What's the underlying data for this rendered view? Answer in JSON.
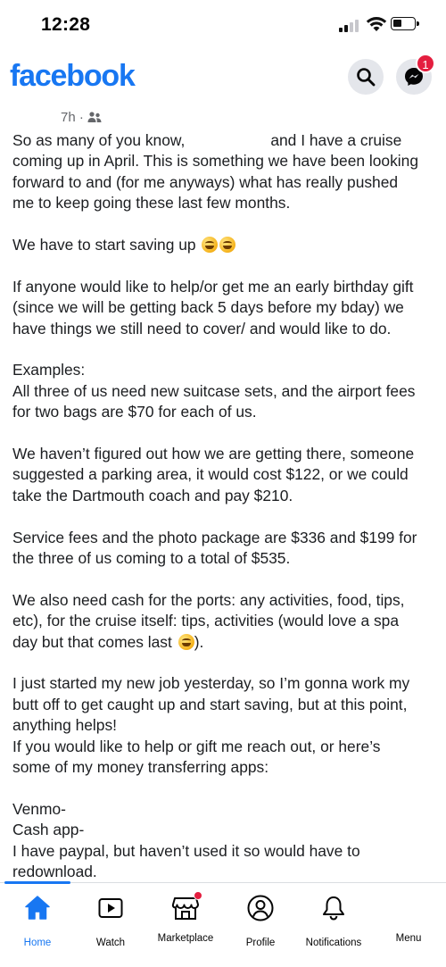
{
  "status_bar": {
    "time": "12:28"
  },
  "header": {
    "logo": "facebook",
    "messenger_badge": "1"
  },
  "post": {
    "time_ago": "7h ·",
    "paragraphs": {
      "p1_a": "So as many of you know,",
      "p1_b": "and I have a cruise\ncoming up in April. This is something we have been looking\nforward to and (for me anyways) what has really pushed\nme to keep going these last few months.",
      "p2": "We have to start saving up",
      "p3": "If anyone would like to help/or get me an early birthday gift\n(since we will be getting back 5 days before my bday) we\nhave things we still need to cover/ and would like to do.",
      "p4": "Examples:\nAll three of us need new suitcase sets, and the airport fees\nfor two bags are $70 for each of us.",
      "p5": "We haven’t figured out how we are getting there, someone\nsuggested a parking area, it would cost $122, or we could\ntake the Dartmouth coach and pay $210.",
      "p6": "Service fees and the photo package are $336 and $199 for\nthe three of us coming to a total of $535.",
      "p7_a": "We also need cash for the ports: any activities, food, tips,\netc), for the cruise itself: tips, activities (would love a spa\nday but that comes last",
      "p7_b": ").",
      "p8": "I just started my new job yesterday, so I’m gonna work my\nbutt off to get caught up and start saving, but at this point,\nanything helps!\nIf you would like to help or gift me reach out, or here’s\nsome of my money transferring apps:",
      "p9": "Venmo-\nCash app-\nI have paypal, but haven’t used it so would have to\nredownload."
    }
  },
  "tabs": [
    {
      "label": "Home",
      "icon": "home-icon",
      "active": true
    },
    {
      "label": "Watch",
      "icon": "watch-icon"
    },
    {
      "label": "Marketplace",
      "icon": "marketplace-icon"
    },
    {
      "label": "Profile",
      "icon": "profile-icon"
    },
    {
      "label": "Notifications",
      "icon": "bell-icon"
    },
    {
      "label": "Menu",
      "icon": "menu-icon"
    }
  ],
  "colors": {
    "brand": "#1877f2",
    "badge": "#e41e3f",
    "muted": "#65676b"
  }
}
